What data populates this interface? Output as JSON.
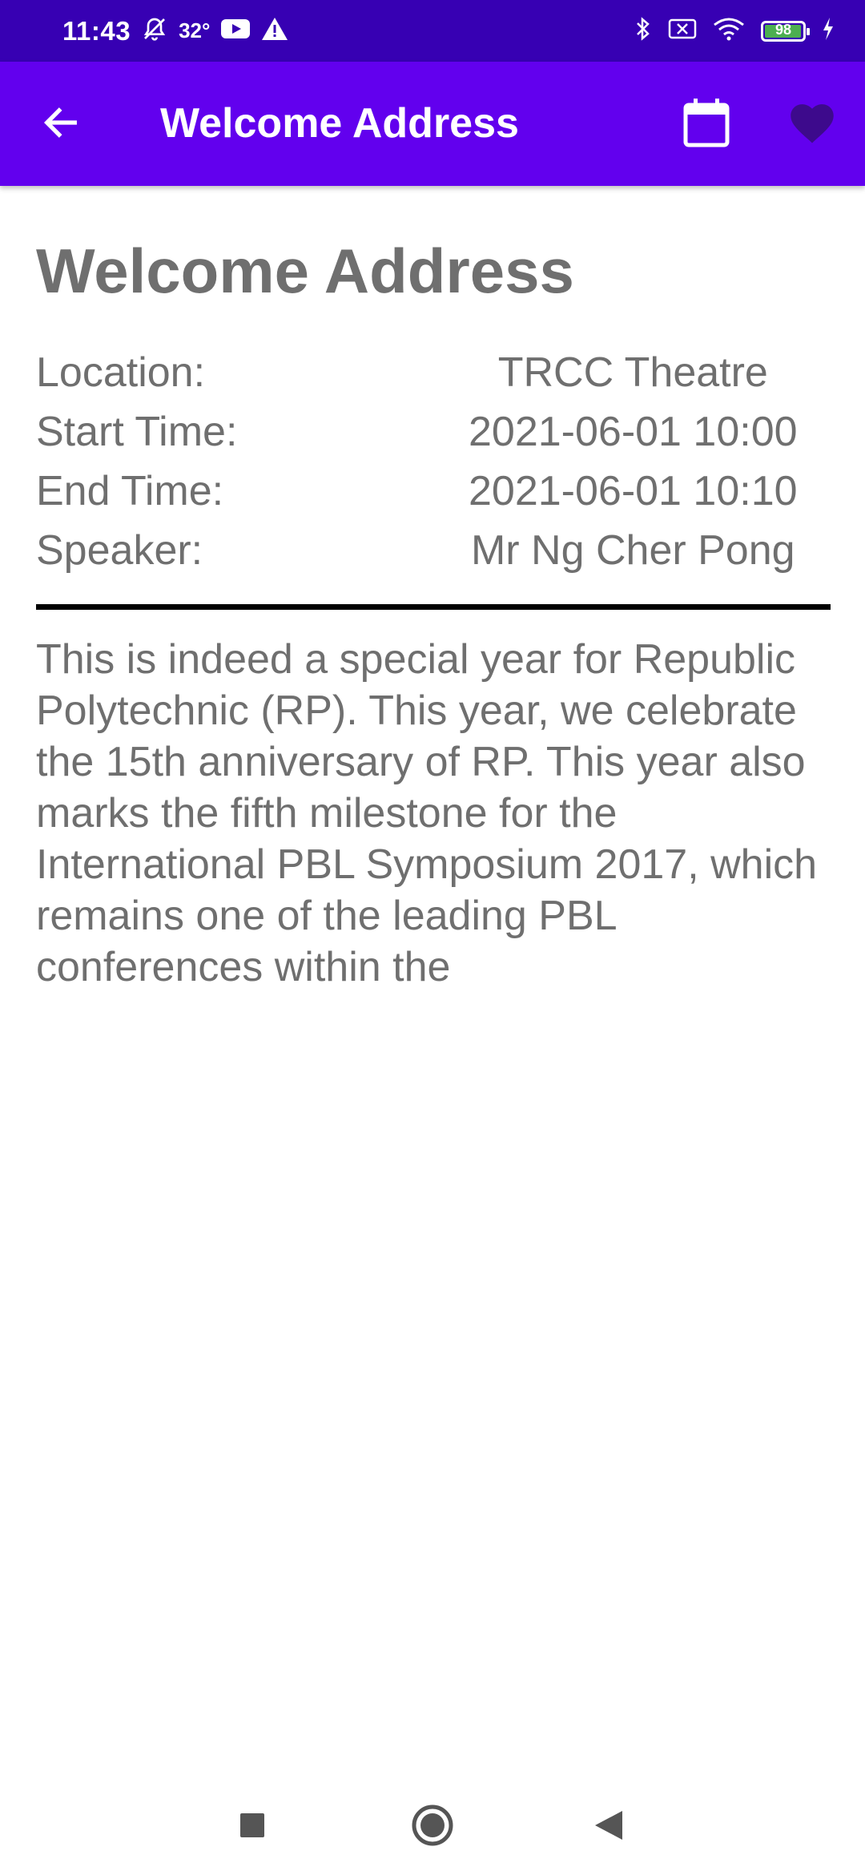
{
  "status_bar": {
    "time": "11:43",
    "temperature": "32°",
    "battery": "98",
    "left_icons": [
      "alarm-off-icon",
      "youtube-icon",
      "warning-icon"
    ],
    "right_icons": [
      "bluetooth-icon",
      "sim-off-icon",
      "wifi-icon",
      "battery-icon",
      "charging-icon"
    ],
    "battery_level": 0.98
  },
  "app_bar": {
    "title": "Welcome Address",
    "back_icon": "arrow-back-icon",
    "calendar_icon": "calendar-icon",
    "favorite_icon": "heart-icon",
    "color": "#6200ee",
    "status_color": "#3700b3"
  },
  "event": {
    "title": "Welcome Address",
    "details": [
      {
        "label": "Location:",
        "value": "TRCC Theatre"
      },
      {
        "label": "Start Time:",
        "value": "2021-06-01 10:00"
      },
      {
        "label": "End Time:",
        "value": "2021-06-01 10:10"
      },
      {
        "label": "Speaker:",
        "value": "Mr Ng Cher Pong"
      }
    ],
    "description": "This is indeed a special year for Republic Polytechnic (RP). This year, we celebrate the 15th anniversary of RP. This year also marks the fifth milestone for the International PBL Symposium 2017, which remains one of the leading PBL conferences within the"
  },
  "nav_bar": {
    "icons": [
      "recents-square-icon",
      "home-circle-icon",
      "back-triangle-icon"
    ]
  }
}
